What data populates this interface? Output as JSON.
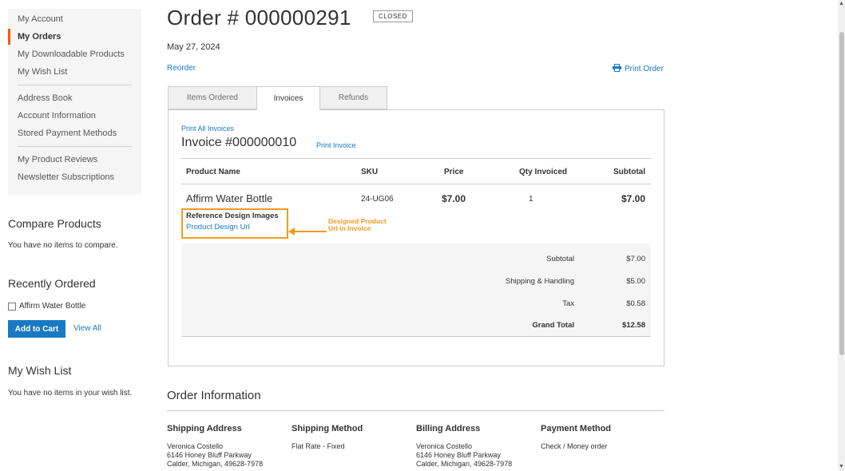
{
  "sidebar": {
    "nav_group1": [
      {
        "label": "My Account",
        "current": false
      },
      {
        "label": "My Orders",
        "current": true
      },
      {
        "label": "My Downloadable Products",
        "current": false
      },
      {
        "label": "My Wish List",
        "current": false
      }
    ],
    "nav_group2": [
      {
        "label": "Address Book"
      },
      {
        "label": "Account Information"
      },
      {
        "label": "Stored Payment Methods"
      }
    ],
    "nav_group3": [
      {
        "label": "My Product Reviews"
      },
      {
        "label": "Newsletter Subscriptions"
      }
    ],
    "compare": {
      "title": "Compare Products",
      "empty_text": "You have no items to compare."
    },
    "recently_ordered": {
      "title": "Recently Ordered",
      "item_label": "Affirm Water Bottle",
      "add_to_cart": "Add to Cart",
      "view_all": "View All"
    },
    "wishlist": {
      "title": "My Wish List",
      "empty_text": "You have no items in your wish list."
    }
  },
  "order": {
    "title": "Order # 000000291",
    "status": "CLOSED",
    "date": "May 27, 2024",
    "reorder": "Reorder",
    "print_order": "Print Order"
  },
  "tabs": [
    {
      "label": "Items Ordered",
      "active": false
    },
    {
      "label": "Invoices",
      "active": true
    },
    {
      "label": "Refunds",
      "active": false
    }
  ],
  "invoice": {
    "print_all": "Print All Invoices",
    "title": "Invoice #000000010",
    "print_invoice": "Print Invoice",
    "columns": {
      "product_name": "Product Name",
      "sku": "SKU",
      "price": "Price",
      "qty": "Qty Invoiced",
      "subtotal": "Subtotal"
    },
    "item": {
      "name": "Affirm Water Bottle",
      "sku": "24-UG06",
      "price": "$7.00",
      "qty": "1",
      "subtotal": "$7.00",
      "option_title": "Reference Design Images",
      "option_link": "Product Design Url"
    },
    "annotation": "Designed Product Url in Invoice",
    "totals": [
      {
        "label": "Subtotal",
        "value": "$7.00",
        "bold": false
      },
      {
        "label": "Shipping & Handling",
        "value": "$5.00",
        "bold": false
      },
      {
        "label": "Tax",
        "value": "$0.58",
        "bold": false
      },
      {
        "label": "Grand Total",
        "value": "$12.58",
        "bold": true
      }
    ]
  },
  "order_information": {
    "title": "Order Information",
    "shipping_address": {
      "heading": "Shipping Address",
      "lines": [
        "Veronica Costello",
        "6146 Honey Bluff Parkway",
        "Calder, Michigan, 49628-7978"
      ]
    },
    "shipping_method": {
      "heading": "Shipping Method",
      "value": "Flat Rate - Fixed"
    },
    "billing_address": {
      "heading": "Billing Address",
      "lines": [
        "Veronica Costello",
        "6146 Honey Bluff Parkway",
        "Calder, Michigan, 49628-7978"
      ]
    },
    "payment_method": {
      "heading": "Payment Method",
      "value": "Check / Money order"
    }
  },
  "colors": {
    "accent": "#1979c3",
    "nav_marker": "#ff5501",
    "annotation": "#f39a1e"
  },
  "icons": {
    "print": "printer-icon",
    "checkbox": "checkbox-icon"
  }
}
